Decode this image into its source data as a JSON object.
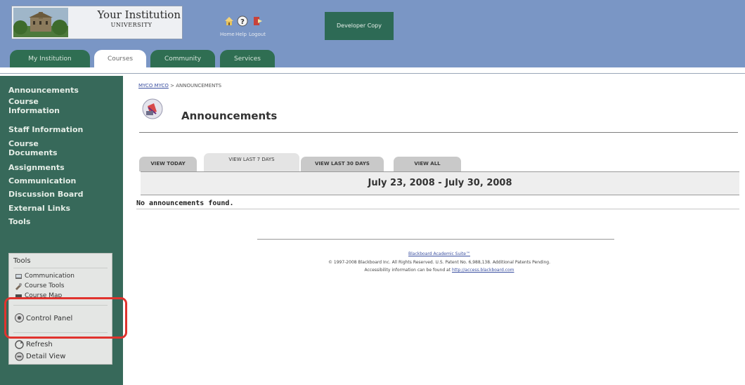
{
  "header": {
    "logo_title": "Your Institution",
    "logo_subtitle": "UNIVERSITY",
    "icons": [
      {
        "name": "home-icon",
        "label": "Home"
      },
      {
        "name": "help-icon",
        "label": "Help"
      },
      {
        "name": "logout-icon",
        "label": "Logout"
      }
    ],
    "developer_copy": "Developer Copy"
  },
  "tabs": [
    {
      "label": "My Institution",
      "active": false
    },
    {
      "label": "Courses",
      "active": true
    },
    {
      "label": "Community",
      "active": false
    },
    {
      "label": "Services",
      "active": false
    }
  ],
  "sidebar": {
    "links": [
      "Announcements",
      "Course\nInformation",
      "Staff Information",
      "Course\nDocuments",
      "Assignments",
      "Communication",
      "Discussion Board",
      "External Links",
      "Tools"
    ],
    "toolbox": {
      "title": "Tools",
      "items": [
        {
          "label": "Communication",
          "icon": "communication-icon"
        },
        {
          "label": "Course Tools",
          "icon": "course-tools-icon"
        },
        {
          "label": "Course Map",
          "icon": "course-map-icon"
        },
        {
          "label": "Control Panel",
          "icon": "control-panel-icon"
        },
        {
          "label": "Refresh",
          "icon": "refresh-icon"
        },
        {
          "label": "Detail View",
          "icon": "detail-view-icon"
        }
      ]
    }
  },
  "main": {
    "breadcrumb": {
      "link": "MYCO MYCO",
      "current": "ANNOUNCEMENTS",
      "separator": ">"
    },
    "title": "Announcements",
    "view_tabs": [
      {
        "label": "VIEW TODAY",
        "active": false
      },
      {
        "label": "VIEW LAST 7 DAYS",
        "active": true
      },
      {
        "label": "VIEW LAST 30 DAYS",
        "active": false
      },
      {
        "label": "VIEW ALL",
        "active": false
      }
    ],
    "date_range": "July 23, 2008 - July 30, 2008",
    "empty_message": "No announcements found.",
    "footer": {
      "product_link": "Blackboard Academic Suite™",
      "copyright": "© 1997-2008 Blackboard Inc. All Rights Reserved. U.S. Patent No. 6,988,138. Additional Patents Pending.",
      "accessibility_text": "Accessibility information can be found at",
      "accessibility_link": "http://access.blackboard.com"
    }
  },
  "colors": {
    "header_blue": "#7a96c5",
    "sidebar_green": "#37695a",
    "tab_green": "#2f6e52",
    "highlight_red": "#e0332e"
  }
}
